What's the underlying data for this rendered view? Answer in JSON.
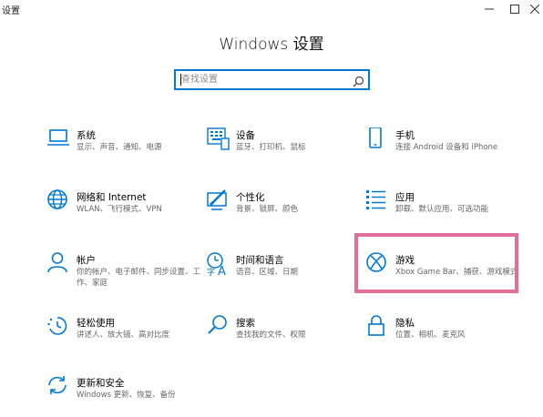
{
  "window": {
    "title": "设置"
  },
  "header": {
    "title": "Windows 设置"
  },
  "search": {
    "placeholder": "查找设置"
  },
  "tiles": [
    {
      "label": "系统",
      "desc": "显示、声音、通知、电源",
      "icon": "laptop-icon"
    },
    {
      "label": "设备",
      "desc": "蓝牙、打印机、鼠标",
      "icon": "keyboard-device-icon"
    },
    {
      "label": "手机",
      "desc": "连接 Android 设备和 iPhone",
      "icon": "phone-icon"
    },
    {
      "label": "网络和 Internet",
      "desc": "WLAN、飞行模式、VPN",
      "icon": "globe-icon"
    },
    {
      "label": "个性化",
      "desc": "背景、锁屏、颜色",
      "icon": "paint-monitor-icon"
    },
    {
      "label": "应用",
      "desc": "卸载、默认应用、可选功能",
      "icon": "apps-list-icon"
    },
    {
      "label": "帐户",
      "desc": "你的帐户、电子邮件、同步设置、工作、家庭",
      "icon": "person-icon"
    },
    {
      "label": "时间和语言",
      "desc": "语音、区域、日期",
      "icon": "time-language-icon"
    },
    {
      "label": "游戏",
      "desc": "Xbox Game Bar、捕获、游戏模式",
      "icon": "xbox-icon"
    },
    {
      "label": "轻松使用",
      "desc": "讲述人、放大镜、高对比度",
      "icon": "ease-of-access-icon"
    },
    {
      "label": "搜索",
      "desc": "查找我的文件、权限",
      "icon": "search-icon"
    },
    {
      "label": "隐私",
      "desc": "位置、相机、麦克风",
      "icon": "lock-icon"
    },
    {
      "label": "更新和安全",
      "desc": "Windows 更新、恢复、备份",
      "icon": "sync-icon"
    }
  ],
  "colors": {
    "accent": "#0078d7",
    "highlight": "#e0709a"
  }
}
